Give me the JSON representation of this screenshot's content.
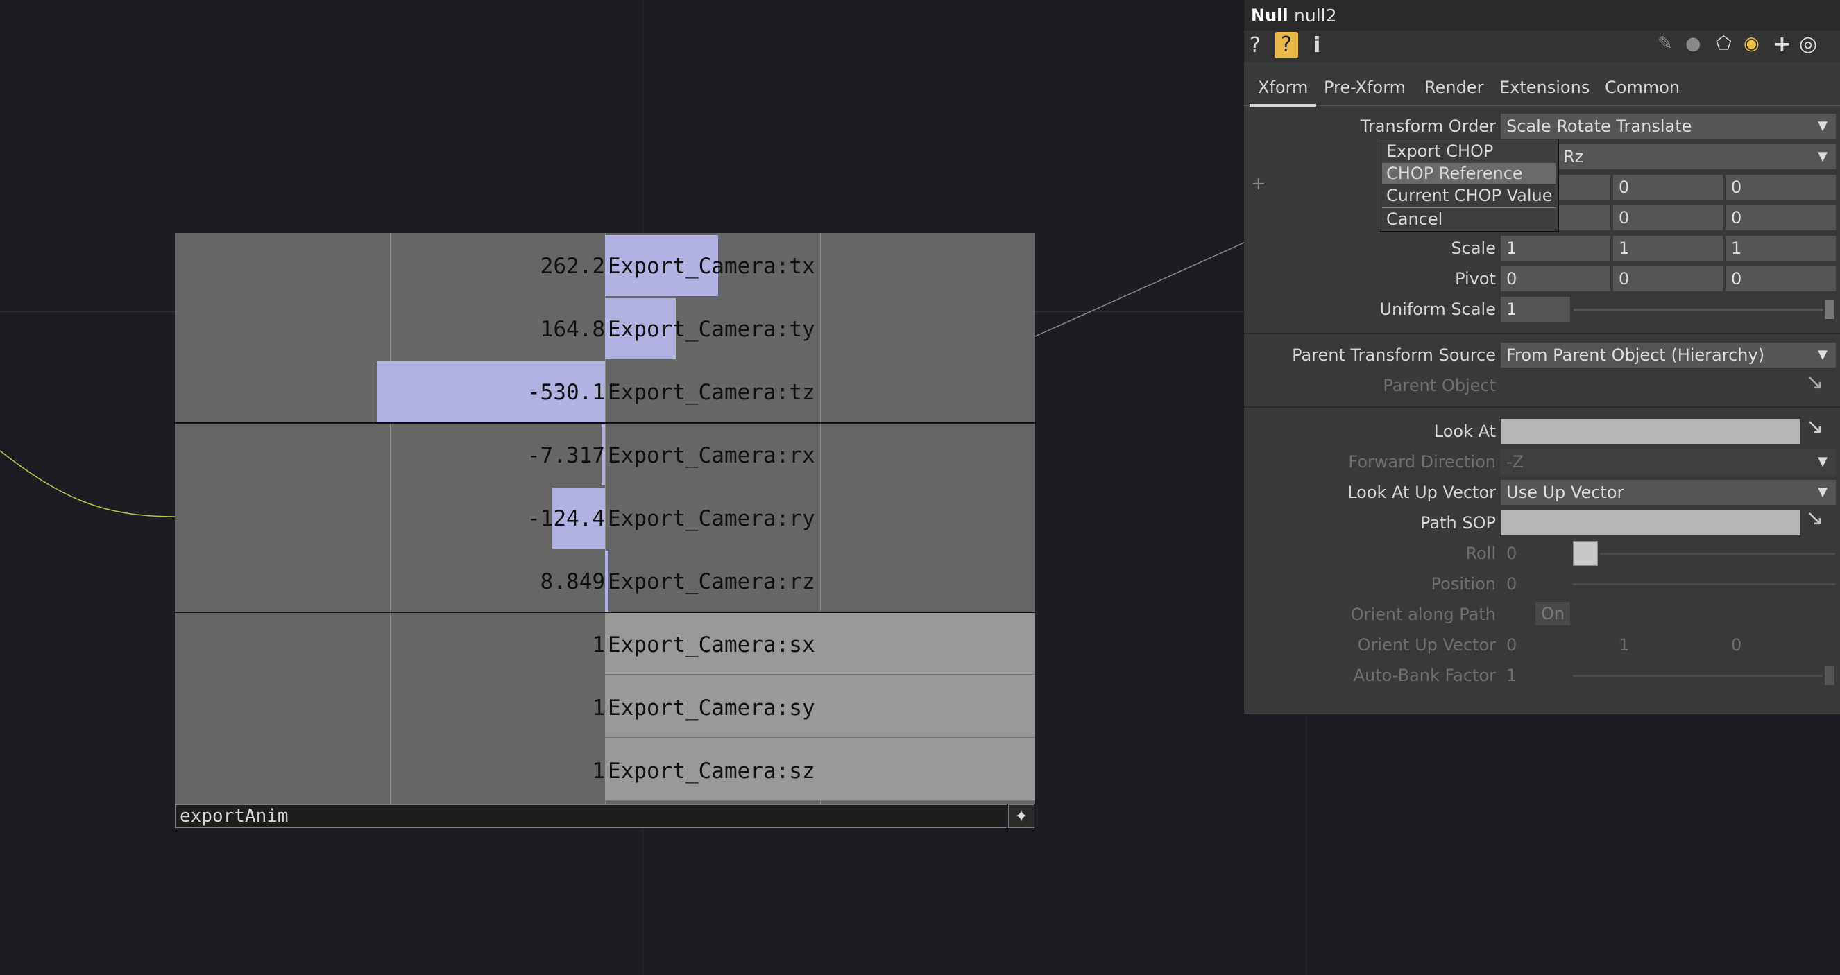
{
  "network": {
    "curve_color": "#b3c84a"
  },
  "chop_viewer": {
    "channels": [
      {
        "name": "Export_Camera:tx",
        "value": "262.2",
        "bar": 262.2
      },
      {
        "name": "Export_Camera:ty",
        "value": "164.8",
        "bar": 164.8
      },
      {
        "name": "Export_Camera:tz",
        "value": "-530.1",
        "bar": -530.1
      },
      {
        "name": "Export_Camera:rx",
        "value": "-7.317",
        "bar": -7.317
      },
      {
        "name": "Export_Camera:ry",
        "value": "-124.4",
        "bar": -124.4
      },
      {
        "name": "Export_Camera:rz",
        "value": "8.849",
        "bar": 8.849
      },
      {
        "name": "Export_Camera:sx",
        "value": "1",
        "bar": 1
      },
      {
        "name": "Export_Camera:sy",
        "value": "1",
        "bar": 1
      },
      {
        "name": "Export_Camera:sz",
        "value": "1",
        "bar": 1
      }
    ],
    "node_name": "exportAnim",
    "bar_color": "#b2b2e2"
  },
  "panel": {
    "type": "Null",
    "name": "null2",
    "tabs": [
      "Xform",
      "Pre-Xform",
      "Render",
      "Extensions",
      "Common"
    ],
    "transform_order": {
      "label": "Transform Order",
      "value": "Scale Rotate Translate"
    },
    "rotate_order_value": "Rz",
    "translate": [
      "0",
      "0"
    ],
    "rotate": [
      "0",
      "0"
    ],
    "scale": {
      "label": "Scale",
      "values": [
        "1",
        "1",
        "1"
      ]
    },
    "pivot": {
      "label": "Pivot",
      "values": [
        "0",
        "0",
        "0"
      ]
    },
    "uniform_scale": {
      "label": "Uniform Scale",
      "value": "1"
    },
    "parent_transform_source": {
      "label": "Parent Transform Source",
      "value": "From Parent Object (Hierarchy)"
    },
    "parent_object": {
      "label": "Parent Object"
    },
    "look_at": {
      "label": "Look At"
    },
    "forward_direction": {
      "label": "Forward Direction",
      "value": "-Z"
    },
    "look_at_up_vector": {
      "label": "Look At Up Vector",
      "value": "Use Up Vector"
    },
    "path_sop": {
      "label": "Path SOP"
    },
    "roll": {
      "label": "Roll",
      "value": "0"
    },
    "position": {
      "label": "Position",
      "value": "0"
    },
    "orient_along_path": {
      "label": "Orient along Path",
      "value": "On"
    },
    "orient_up_vector": {
      "label": "Orient Up Vector",
      "values": [
        "0",
        "1",
        "0"
      ]
    },
    "auto_bank": {
      "label": "Auto-Bank Factor",
      "value": "1"
    }
  },
  "menu": {
    "items": [
      "Export CHOP",
      "CHOP Reference",
      "Current CHOP Value",
      "Cancel"
    ],
    "highlighted": 1
  }
}
